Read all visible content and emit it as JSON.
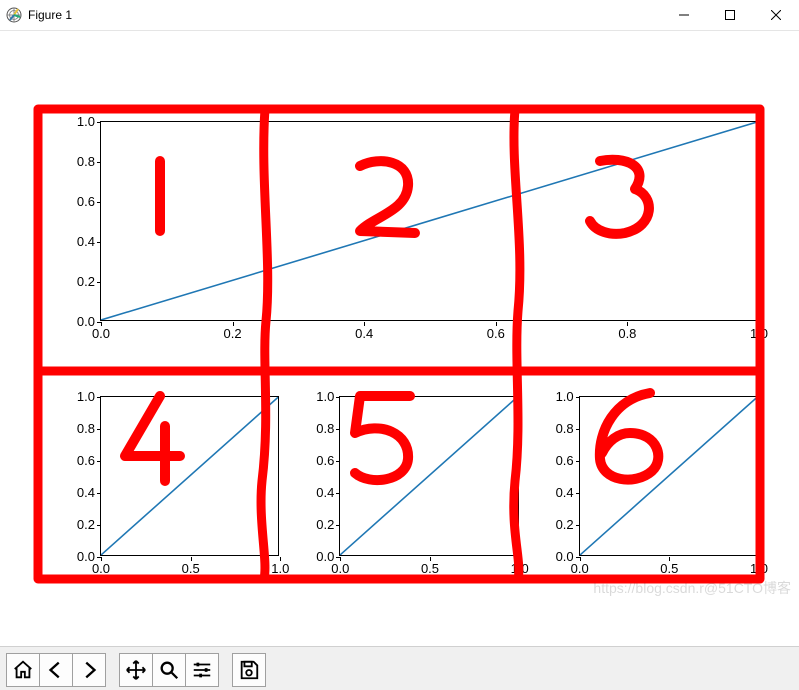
{
  "window": {
    "title": "Figure 1",
    "minimize_label": "Minimize",
    "maximize_label": "Maximize",
    "close_label": "Close"
  },
  "toolbar": {
    "home_label": "Home",
    "back_label": "Back",
    "forward_label": "Forward",
    "pan_label": "Pan",
    "zoom_label": "Zoom",
    "subplots_label": "Configure subplots",
    "save_label": "Save"
  },
  "watermark": "https://blog.csdn.r@51CTO博客",
  "annotations": {
    "cell1": "1",
    "cell2": "2",
    "cell3": "3",
    "cell4": "4",
    "cell5": "5",
    "cell6": "6"
  },
  "chart_data": [
    {
      "subplot": "top (spans 3 columns, grid cells 1-3)",
      "type": "line",
      "x": [
        0.0,
        1.0
      ],
      "y": [
        0.0,
        1.0
      ],
      "xlim": [
        0.0,
        1.0
      ],
      "ylim": [
        0.0,
        1.0
      ],
      "xticks": [
        0.0,
        0.2,
        0.4,
        0.6,
        0.8,
        1.0
      ],
      "yticks": [
        0.0,
        0.2,
        0.4,
        0.6,
        0.8,
        1.0
      ],
      "line_color": "#1f77b4"
    },
    {
      "subplot": "bottom-left (grid cell 4)",
      "type": "line",
      "x": [
        0.0,
        1.0
      ],
      "y": [
        0.0,
        1.0
      ],
      "xlim": [
        0.0,
        1.0
      ],
      "ylim": [
        0.0,
        1.0
      ],
      "xticks": [
        0.0,
        0.5,
        1.0
      ],
      "yticks": [
        0.0,
        0.2,
        0.4,
        0.6,
        0.8,
        1.0
      ],
      "line_color": "#1f77b4"
    },
    {
      "subplot": "bottom-middle (grid cell 5)",
      "type": "line",
      "x": [
        0.0,
        1.0
      ],
      "y": [
        0.0,
        1.0
      ],
      "xlim": [
        0.0,
        1.0
      ],
      "ylim": [
        0.0,
        1.0
      ],
      "xticks": [
        0.0,
        0.5,
        1.0
      ],
      "yticks": [
        0.0,
        0.2,
        0.4,
        0.6,
        0.8,
        1.0
      ],
      "line_color": "#1f77b4"
    },
    {
      "subplot": "bottom-right (grid cell 6)",
      "type": "line",
      "x": [
        0.0,
        1.0
      ],
      "y": [
        0.0,
        1.0
      ],
      "xlim": [
        0.0,
        1.0
      ],
      "ylim": [
        0.0,
        1.0
      ],
      "xticks": [
        0.0,
        0.5,
        1.0
      ],
      "yticks": [
        0.0,
        0.2,
        0.4,
        0.6,
        0.8,
        1.0
      ],
      "line_color": "#1f77b4"
    }
  ]
}
